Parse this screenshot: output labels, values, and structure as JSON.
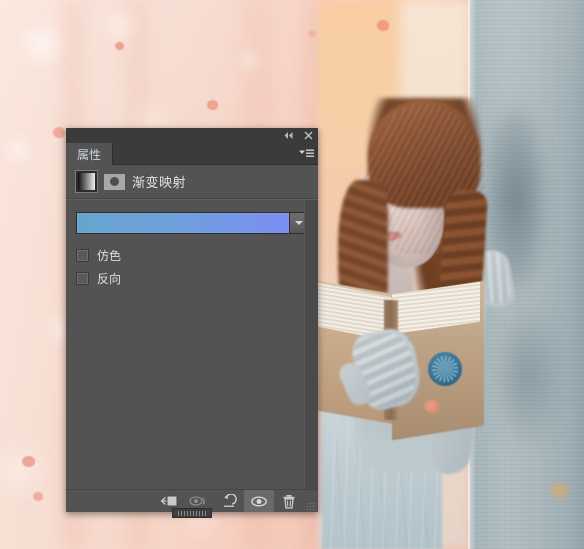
{
  "app": {
    "panel_title": "属性",
    "adjustment_name": "渐变映射"
  },
  "titlebar": {
    "collapse_label": "◀◀",
    "close_label": "✕"
  },
  "panel_menu": {
    "label": "≡"
  },
  "adjustment": {
    "thumbnail_icon": "gradient-thumbnail-icon",
    "clip_icon": "clip-to-layer-icon",
    "name": "渐变映射"
  },
  "gradient": {
    "preview_name": "gradient-preview",
    "dropdown_label": "▼",
    "stops": [
      {
        "position": 0,
        "color": "#66a5ce"
      },
      {
        "position": 48,
        "color": "#6f9fdd"
      },
      {
        "position": 100,
        "color": "#7b8ef1"
      }
    ]
  },
  "options": [
    {
      "label": "仿色",
      "checked": false,
      "name": "dither-checkbox"
    },
    {
      "label": "反向",
      "checked": false,
      "name": "reverse-checkbox"
    }
  ],
  "footer_buttons": [
    {
      "name": "clip-to-layer-button",
      "icon": "clip-to-layer-icon",
      "active": false
    },
    {
      "name": "view-previous-state-button",
      "icon": "eye-arrow-icon",
      "active": false
    },
    {
      "name": "reset-button",
      "icon": "reset-arrow-icon",
      "active": false
    },
    {
      "name": "toggle-visibility-button",
      "icon": "eye-icon",
      "active": true
    },
    {
      "name": "delete-adjustment-button",
      "icon": "trash-icon",
      "active": false
    }
  ],
  "photo": {
    "description": "woman-reading-book-leaning-on-wall"
  }
}
